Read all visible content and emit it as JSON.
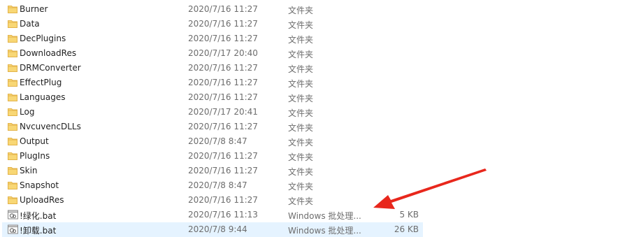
{
  "files": [
    {
      "name": "Burner",
      "date": "2020/7/16 11:27",
      "type": "文件夹",
      "size": "",
      "icon": "folder-icon"
    },
    {
      "name": "Data",
      "date": "2020/7/16 11:27",
      "type": "文件夹",
      "size": "",
      "icon": "folder-icon"
    },
    {
      "name": "DecPlugins",
      "date": "2020/7/16 11:27",
      "type": "文件夹",
      "size": "",
      "icon": "folder-icon"
    },
    {
      "name": "DownloadRes",
      "date": "2020/7/17 20:40",
      "type": "文件夹",
      "size": "",
      "icon": "folder-icon"
    },
    {
      "name": "DRMConverter",
      "date": "2020/7/16 11:27",
      "type": "文件夹",
      "size": "",
      "icon": "folder-icon"
    },
    {
      "name": "EffectPlug",
      "date": "2020/7/16 11:27",
      "type": "文件夹",
      "size": "",
      "icon": "folder-icon"
    },
    {
      "name": "Languages",
      "date": "2020/7/16 11:27",
      "type": "文件夹",
      "size": "",
      "icon": "folder-icon"
    },
    {
      "name": "Log",
      "date": "2020/7/17 20:41",
      "type": "文件夹",
      "size": "",
      "icon": "folder-icon"
    },
    {
      "name": "NvcuvencDLLs",
      "date": "2020/7/16 11:27",
      "type": "文件夹",
      "size": "",
      "icon": "folder-icon"
    },
    {
      "name": "Output",
      "date": "2020/7/8 8:47",
      "type": "文件夹",
      "size": "",
      "icon": "folder-icon"
    },
    {
      "name": "PlugIns",
      "date": "2020/7/16 11:27",
      "type": "文件夹",
      "size": "",
      "icon": "folder-icon"
    },
    {
      "name": "Skin",
      "date": "2020/7/16 11:27",
      "type": "文件夹",
      "size": "",
      "icon": "folder-icon"
    },
    {
      "name": "Snapshot",
      "date": "2020/7/8 8:47",
      "type": "文件夹",
      "size": "",
      "icon": "folder-icon"
    },
    {
      "name": "UploadRes",
      "date": "2020/7/16 11:27",
      "type": "文件夹",
      "size": "",
      "icon": "folder-icon"
    },
    {
      "name": "!绿化.bat",
      "date": "2020/7/16 11:13",
      "type": "Windows 批处理...",
      "size": "5 KB",
      "icon": "batch-file-icon"
    },
    {
      "name": "!卸载.bat",
      "date": "2020/7/8 9:44",
      "type": "Windows 批处理...",
      "size": "26 KB",
      "icon": "batch-file-icon",
      "selected": true
    }
  ],
  "colors": {
    "folder": "#f8d775",
    "folder_dark": "#e3b34a",
    "selection": "#e5f3ff",
    "annotation_arrow": "#e8271c"
  }
}
